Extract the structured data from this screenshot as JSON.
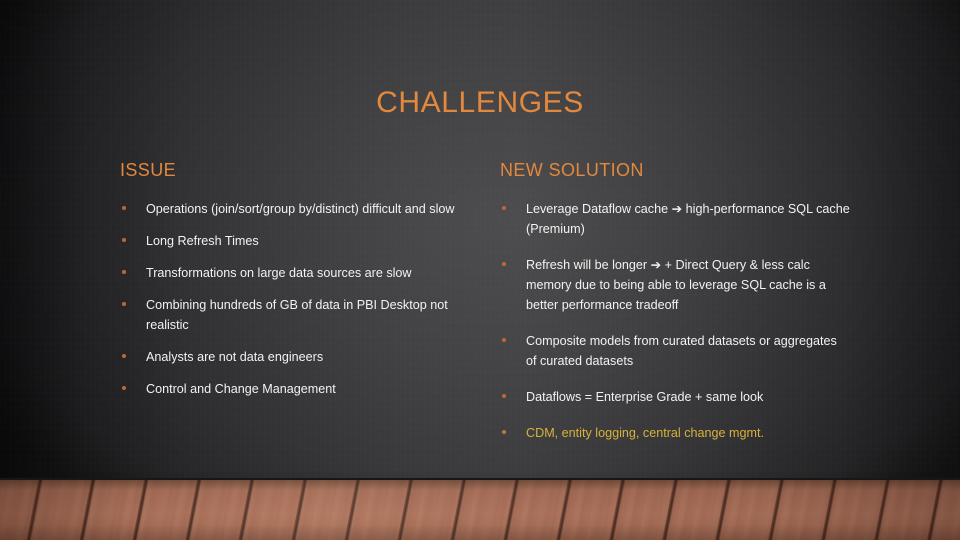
{
  "slide": {
    "title": "CHALLENGES",
    "accent_color": "#e3883d",
    "body_color": "#f2f2f2",
    "highlight_color": "#d7b23a",
    "bullet_color": "#c0663a",
    "wall_color": "#3b3b3b",
    "floor_color": "#a9705a"
  },
  "columns": {
    "left": {
      "heading": "ISSUE",
      "bullets": [
        {
          "text": "Operations (join/sort/group by/distinct) difficult and slow",
          "highlight": false
        },
        {
          "text": "Long Refresh Times",
          "highlight": false
        },
        {
          "text": "Transformations on large data sources are slow",
          "highlight": false
        },
        {
          "text": "Combining hundreds of GB of data in PBI Desktop not realistic",
          "highlight": false
        },
        {
          "text": "Analysts are not data engineers",
          "highlight": false
        },
        {
          "text": "Control and Change Management",
          "highlight": false
        }
      ]
    },
    "right": {
      "heading": "NEW SOLUTION",
      "bullets": [
        {
          "text": "Leverage Dataflow cache ➔ high-performance SQL cache (Premium)",
          "highlight": false
        },
        {
          "text": "Refresh will be longer ➔ + Direct Query & less calc memory due to being able to leverage SQL cache is a better performance tradeoff",
          "highlight": false
        },
        {
          "text": "Composite models from curated datasets or aggregates of curated datasets",
          "highlight": false
        },
        {
          "text": "Dataflows = Enterprise Grade + same look",
          "highlight": false
        },
        {
          "text": "CDM, entity logging, central change mgmt.",
          "highlight": true
        }
      ]
    }
  }
}
